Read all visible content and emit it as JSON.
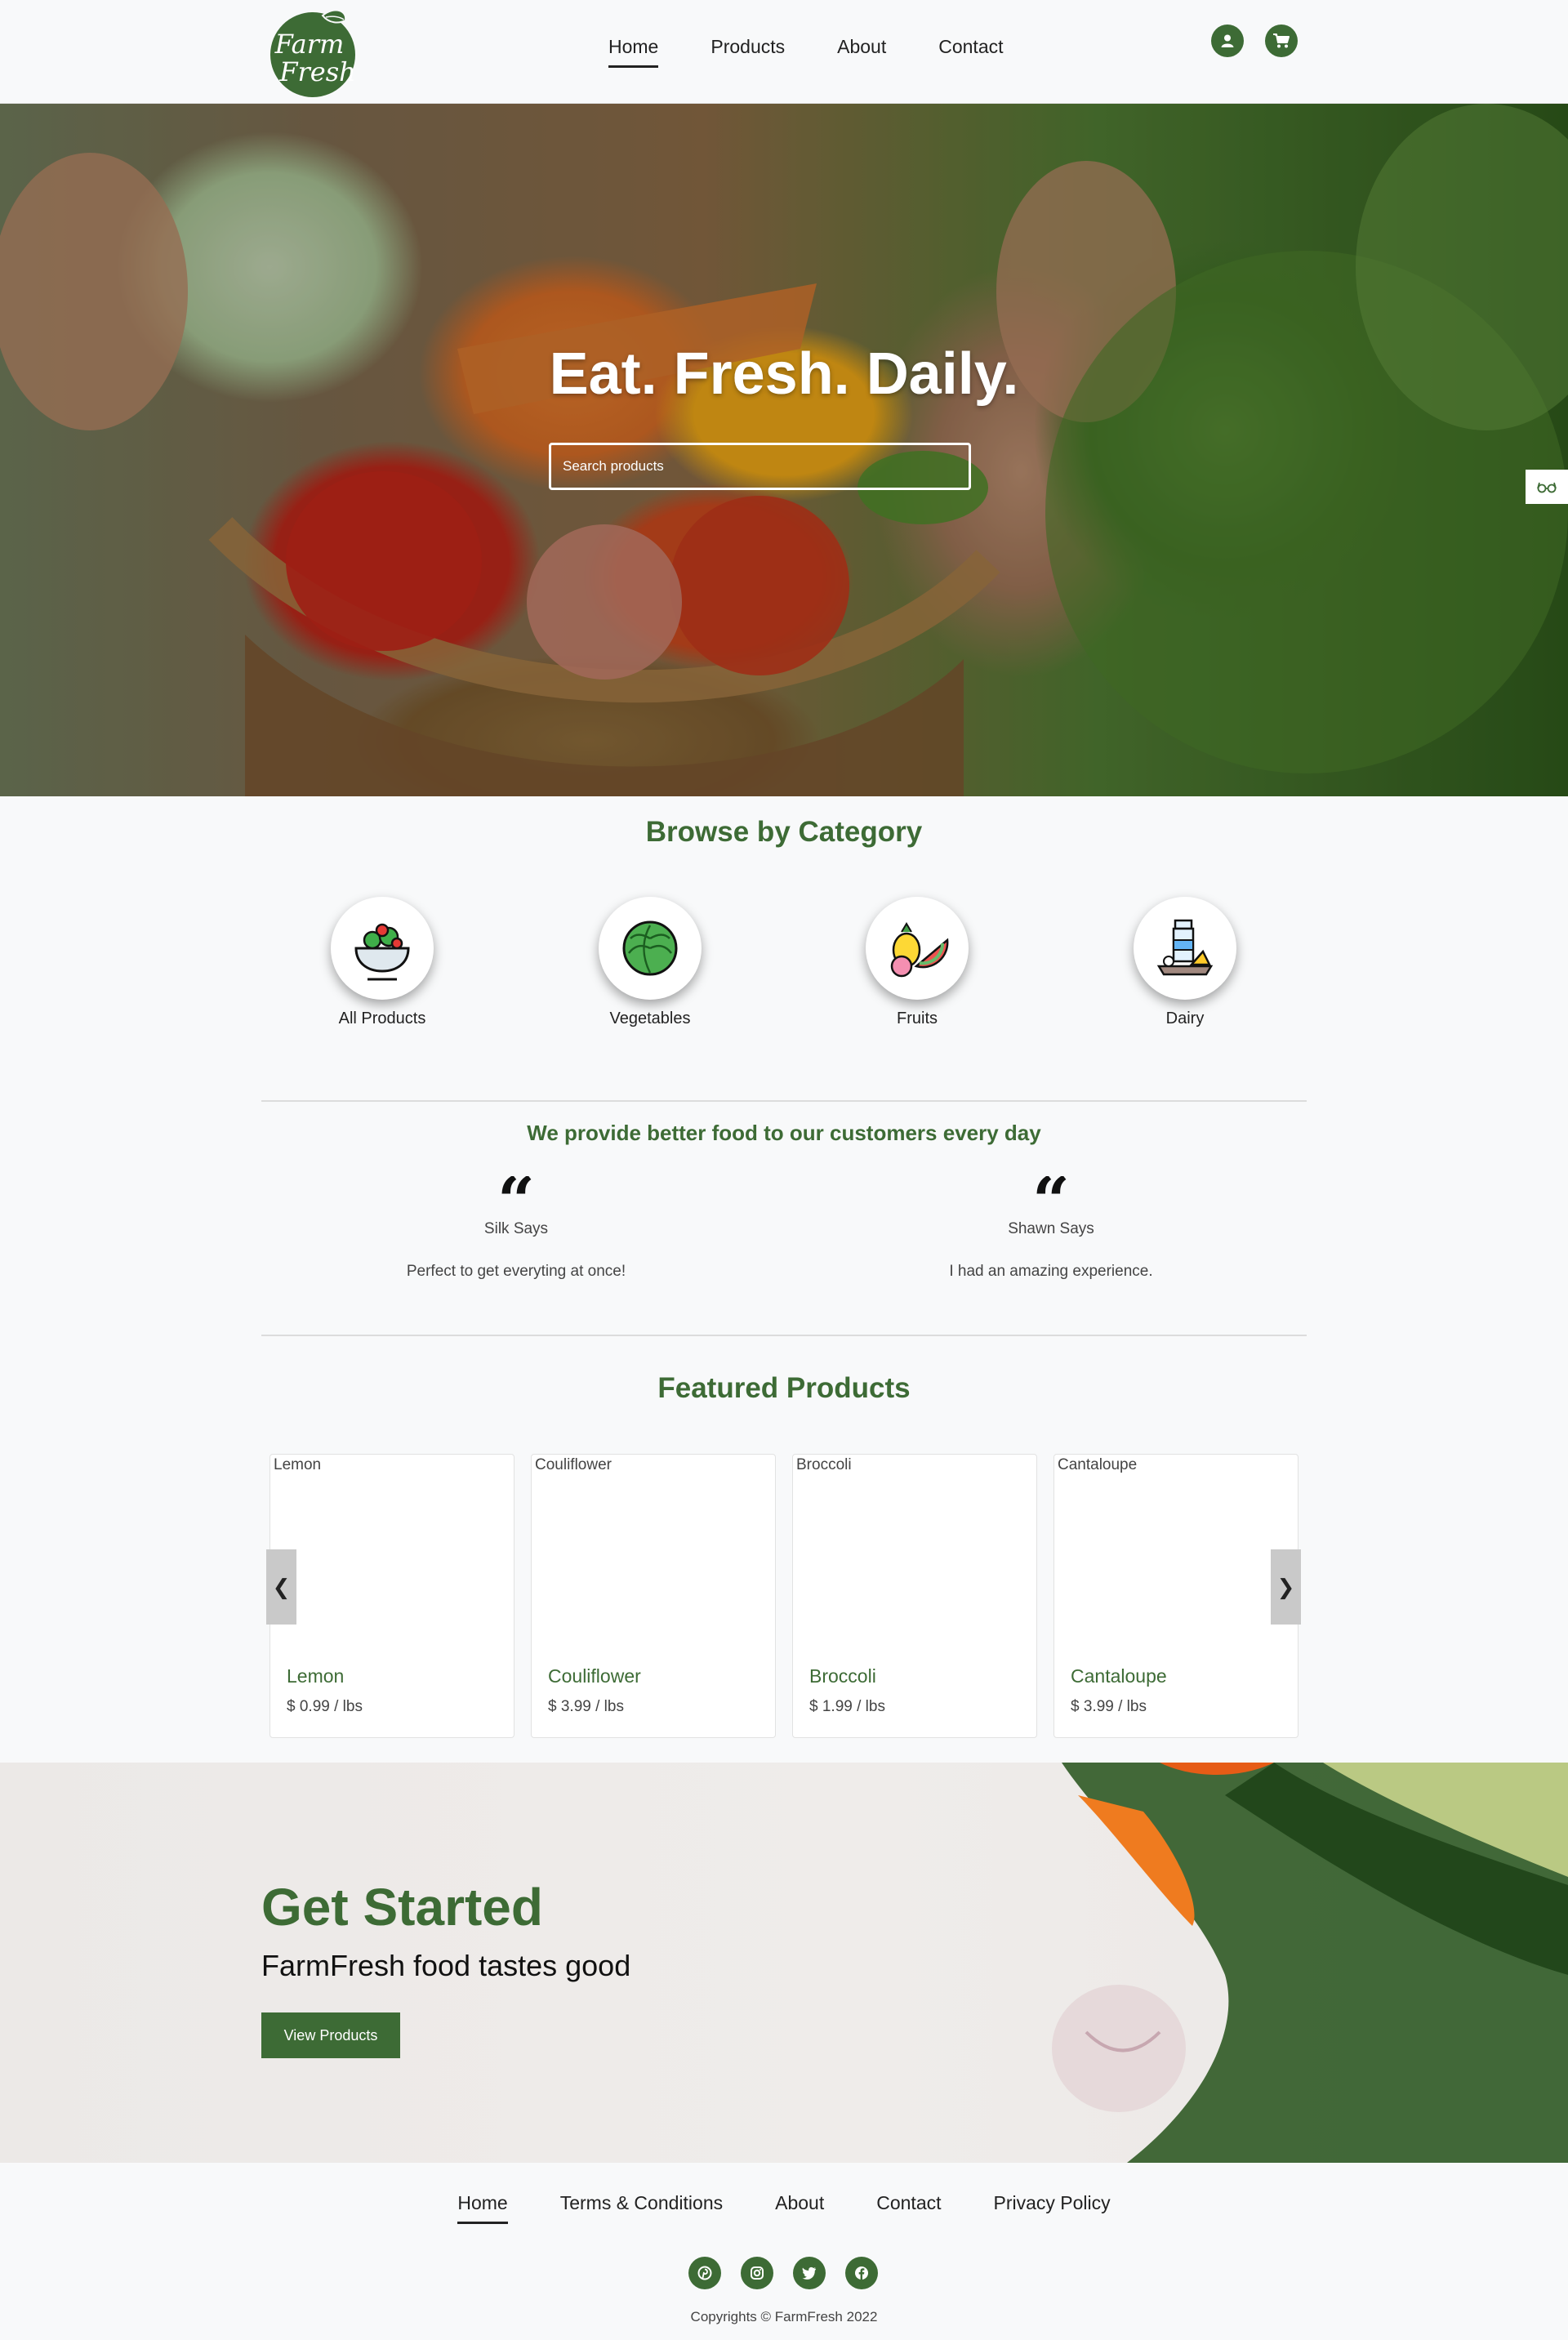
{
  "header": {
    "logo_line1": "Farm",
    "logo_line2": "Fresh",
    "nav": [
      {
        "label": "Home"
      },
      {
        "label": "Products"
      },
      {
        "label": "About"
      },
      {
        "label": "Contact"
      }
    ],
    "icons": [
      "user-icon",
      "cart-icon"
    ]
  },
  "hero": {
    "title": "Eat. Fresh. Daily.",
    "search_placeholder": "Search products",
    "side_widget_icon": "glasses-icon"
  },
  "categories": {
    "title": "Browse by Category",
    "items": [
      {
        "label": "All Products",
        "icon": "salad-bowl-icon"
      },
      {
        "label": "Vegetables",
        "icon": "cabbage-icon"
      },
      {
        "label": "Fruits",
        "icon": "fruits-icon"
      },
      {
        "label": "Dairy",
        "icon": "dairy-icon"
      }
    ]
  },
  "testimonials": {
    "title": "We provide better food to our customers every day",
    "items": [
      {
        "name": "Silk Says",
        "text": "Perfect to get everyting at once!"
      },
      {
        "name": "Shawn Says",
        "text": "I had an amazing experience."
      }
    ]
  },
  "featured": {
    "title": "Featured Products",
    "products": [
      {
        "name": "Lemon",
        "alt": "Lemon",
        "price": "$ 0.99 / lbs"
      },
      {
        "name": "Couliflower",
        "alt": "Couliflower",
        "price": "$ 3.99 / lbs"
      },
      {
        "name": "Broccoli",
        "alt": "Broccoli",
        "price": "$ 1.99 / lbs"
      },
      {
        "name": "Cantaloupe",
        "alt": "Cantaloupe",
        "price": "$ 3.99 / lbs"
      }
    ],
    "prev_arrow": "❮",
    "next_arrow": "❯"
  },
  "get_started": {
    "title": "Get Started",
    "subtitle": "FarmFresh food tastes good",
    "button": "View Products"
  },
  "footer": {
    "nav": [
      {
        "label": "Home"
      },
      {
        "label": "Terms & Conditions"
      },
      {
        "label": "About"
      },
      {
        "label": "Contact"
      },
      {
        "label": "Privacy Policy"
      }
    ],
    "social": [
      "pinterest-icon",
      "instagram-icon",
      "twitter-icon",
      "facebook-icon"
    ],
    "copyright": "Copyrights © FarmFresh 2022"
  },
  "colors": {
    "brand_green": "#3d6b35",
    "background": "#f8f9fa"
  }
}
